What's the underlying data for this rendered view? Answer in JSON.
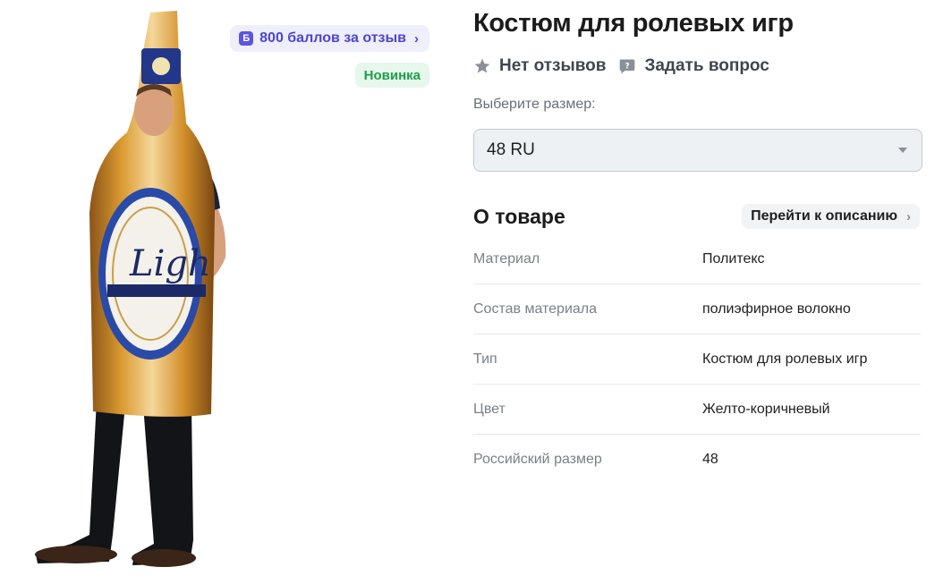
{
  "bonus": {
    "coin": "Б",
    "label": "800 баллов за отзыв",
    "icon": "chevron-right-icon"
  },
  "badge_new": "Новинка",
  "product": {
    "title": "Костюм для ролевых игр",
    "reviews": "Нет отзывов",
    "ask_question": "Задать вопрос"
  },
  "size": {
    "label": "Выберите размер:",
    "selected": "48 RU"
  },
  "about": {
    "title": "О товаре",
    "goto_description": "Перейти к описанию",
    "properties": [
      {
        "name": "Материал",
        "value": "Политекс"
      },
      {
        "name": "Состав материала",
        "value": "полиэфирное волокно"
      },
      {
        "name": "Тип",
        "value": "Костюм для ролевых игр"
      },
      {
        "name": "Цвет",
        "value": "Желто-коричневый"
      },
      {
        "name": "Российский размер",
        "value": "48"
      }
    ]
  },
  "colors": {
    "accent": "#4d45d6",
    "new_badge": "#1e9e4a",
    "select_bg": "#eef1f4"
  }
}
